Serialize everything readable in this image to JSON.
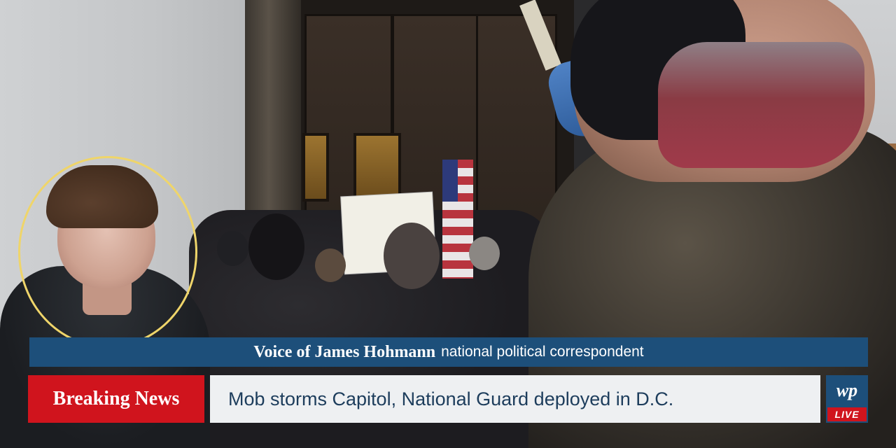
{
  "lower_third": {
    "voice_name": "Voice of James Hohmann",
    "voice_role": "national political correspondent",
    "badge": "Breaking News",
    "headline": "Mob storms Capitol, National Guard deployed in D.C.",
    "logo_text": "wp",
    "live_label": "LIVE"
  },
  "colors": {
    "banner_blue": "#1d4f7a",
    "breaking_red": "#d0141d",
    "headline_bg": "#eef0f2",
    "highlight_circle": "#efd56a"
  }
}
